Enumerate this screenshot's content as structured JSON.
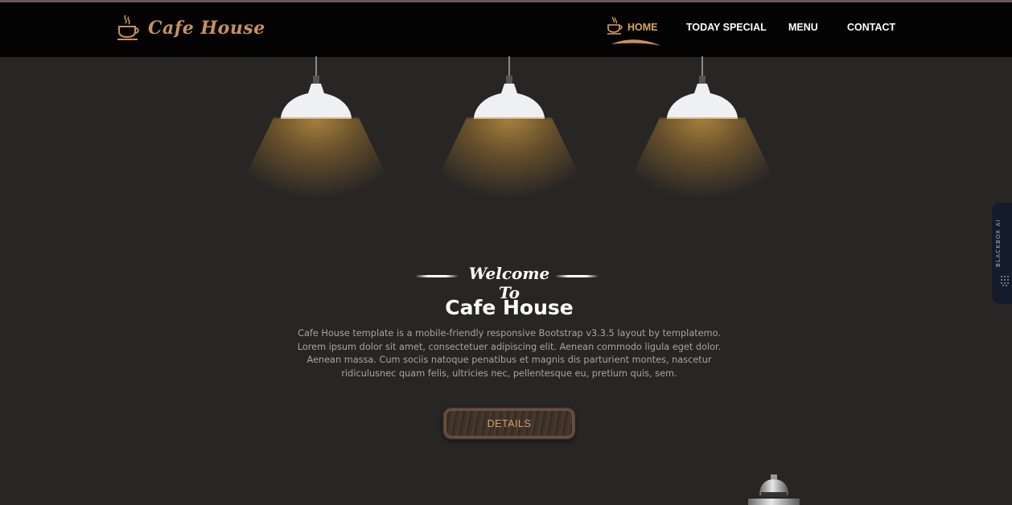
{
  "brand": {
    "name": "Cafe House",
    "logo_icon": "coffee-cup-icon"
  },
  "nav": {
    "items": [
      {
        "label": "HOME",
        "active": true
      },
      {
        "label": "TODAY SPECIAL",
        "active": false
      },
      {
        "label": "MENU",
        "active": false
      },
      {
        "label": "CONTACT",
        "active": false
      }
    ]
  },
  "hero": {
    "welcome": "Welcome To",
    "title": "Cafe House",
    "description": "Cafe House template is a mobile-friendly responsive Bootstrap v3.3.5 layout by templatemo. Lorem ipsum dolor sit amet, consectetuer adipiscing elit. Aenean commodo ligula eget dolor. Aenean massa. Cum sociis natoque penatibus et magnis dis parturient montes, nascetur ridiculusnec quam felis, ultricies nec, pellentesque eu, pretium quis, sem.",
    "button_label": "DETAILS"
  },
  "side_widget": {
    "label": "BLACKBOX AI"
  },
  "colors": {
    "background": "#282625",
    "header": "#030303",
    "accent": "#d9a364",
    "lamp_glow": "#d6a246"
  }
}
